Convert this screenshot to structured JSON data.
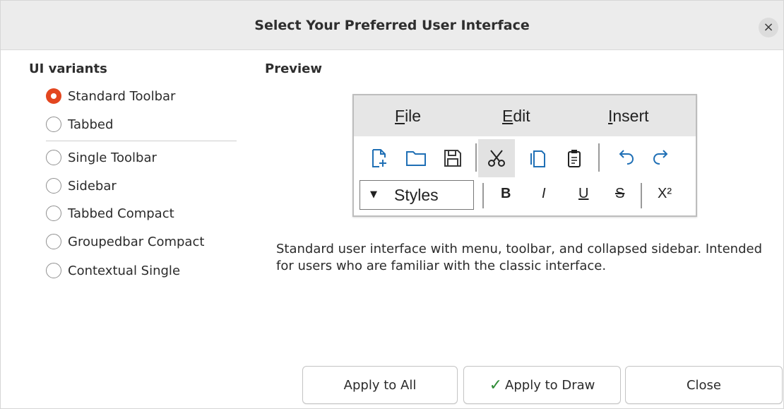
{
  "window": {
    "title": "Select Your Preferred User Interface",
    "close_glyph": "×"
  },
  "variants": {
    "heading": "UI variants",
    "items": [
      {
        "label": "Standard Toolbar",
        "selected": true
      },
      {
        "label": "Tabbed",
        "selected": false
      },
      {
        "label": "Single Toolbar",
        "selected": false
      },
      {
        "label": "Sidebar",
        "selected": false
      },
      {
        "label": "Tabbed Compact",
        "selected": false
      },
      {
        "label": "Groupedbar Compact",
        "selected": false
      },
      {
        "label": "Contextual Single",
        "selected": false
      }
    ]
  },
  "preview": {
    "heading": "Preview",
    "menus": [
      {
        "accel": "F",
        "rest": "ile"
      },
      {
        "accel": "E",
        "rest": "dit"
      },
      {
        "accel": "I",
        "rest": "nsert"
      }
    ],
    "toolbar_icons": [
      "new-document-icon",
      "open-folder-icon",
      "save-icon",
      "cut-icon",
      "copy-icon",
      "paste-icon",
      "undo-icon",
      "redo-icon"
    ],
    "styles_label": "Styles",
    "styles_arrow": "▼",
    "format": {
      "bold": "B",
      "italic": "I",
      "underline": "U",
      "strike": "S",
      "superscript": "X²"
    }
  },
  "description": "Standard user interface with menu, toolbar, and collapsed sidebar. Intended for users who are familiar with the classic interface.",
  "buttons": {
    "apply_all": "Apply to All",
    "apply_draw_check": "✓",
    "apply_draw": "Apply to Draw",
    "close": "Close"
  },
  "colors": {
    "accent": "#e3461f",
    "check": "#2e8b35",
    "titlebar": "#ececec"
  }
}
